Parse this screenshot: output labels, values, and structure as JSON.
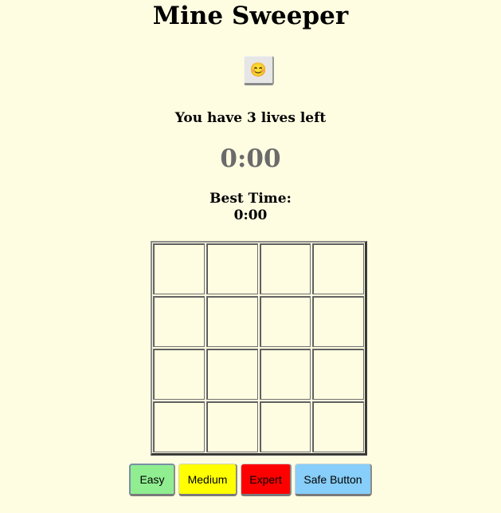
{
  "game": {
    "title": "Mine Sweeper",
    "face": "😊",
    "lives_text": "You have 3 lives left",
    "timer": "0:00",
    "best_time_label": "Best Time:",
    "best_time_value": "0:00"
  },
  "board": {
    "rows": 4,
    "cols": 4
  },
  "modes": {
    "easy": "Easy",
    "medium": "Medium",
    "expert": "Expert",
    "safe": "Safe Button"
  },
  "colors": {
    "background": "#fffde1",
    "easy": "#90ee90",
    "medium": "#ffff00",
    "expert": "#ff0000",
    "safe": "#87cefa"
  }
}
